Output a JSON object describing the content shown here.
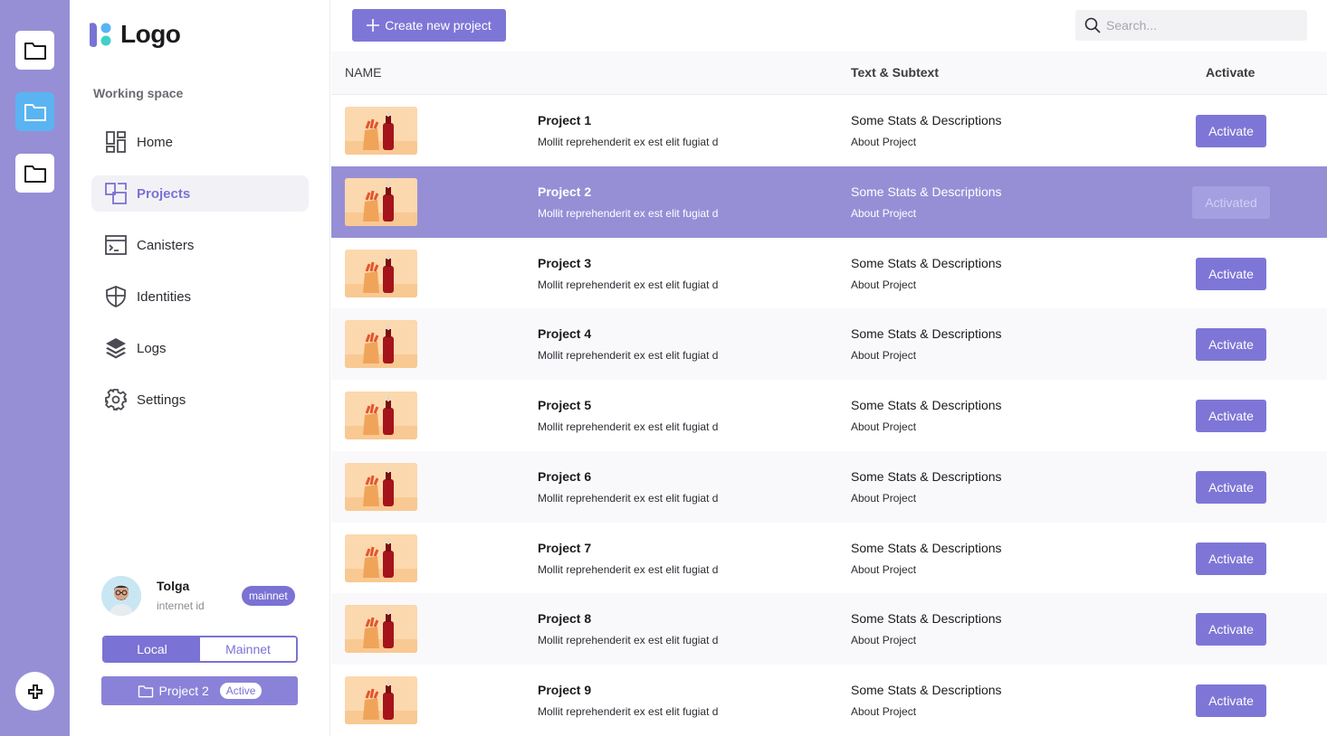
{
  "rail": {
    "items": [
      "folder-icon",
      "folder-icon",
      "folder-icon"
    ],
    "active_index": 1,
    "add": "plus-icon"
  },
  "sidebar": {
    "logo_text": "Logo",
    "section_title": "Working space",
    "nav": [
      {
        "label": "Home",
        "icon": "dashboard-icon"
      },
      {
        "label": "Projects",
        "icon": "projects-icon",
        "active": true
      },
      {
        "label": "Canisters",
        "icon": "terminal-icon"
      },
      {
        "label": "Identities",
        "icon": "shield-icon"
      },
      {
        "label": "Logs",
        "icon": "layers-icon"
      },
      {
        "label": "Settings",
        "icon": "gear-icon"
      }
    ],
    "user": {
      "name": "Tolga",
      "subtitle": "internet id",
      "network_badge": "mainnet"
    },
    "network_toggle": {
      "options": [
        "Local",
        "Mainnet"
      ],
      "selected": "Local"
    },
    "current_project": {
      "name": "Project 2",
      "status": "Active"
    }
  },
  "toolbar": {
    "create_label": "Create new project",
    "search_placeholder": "Search..."
  },
  "table": {
    "headers": {
      "name": "NAME",
      "text": "Text & Subtext",
      "activate": "Activate"
    },
    "rows": [
      {
        "name": "Project 1",
        "desc": "Mollit reprehenderit ex est elit fugiat d",
        "stat": "Some Stats & Descriptions",
        "about": "About Project",
        "button": "Activate"
      },
      {
        "name": "Project 2",
        "desc": "Mollit reprehenderit ex est elit fugiat d",
        "stat": "Some Stats & Descriptions",
        "about": "About Project",
        "button": "Activated",
        "selected": true
      },
      {
        "name": "Project 3",
        "desc": "Mollit reprehenderit ex est elit fugiat d",
        "stat": "Some Stats & Descriptions",
        "about": "About Project",
        "button": "Activate"
      },
      {
        "name": "Project 4",
        "desc": "Mollit reprehenderit ex est elit fugiat d",
        "stat": "Some Stats & Descriptions",
        "about": "About Project",
        "button": "Activate"
      },
      {
        "name": "Project 5",
        "desc": "Mollit reprehenderit ex est elit fugiat d",
        "stat": "Some Stats & Descriptions",
        "about": "About Project",
        "button": "Activate"
      },
      {
        "name": "Project 6",
        "desc": "Mollit reprehenderit ex est elit fugiat d",
        "stat": "Some Stats & Descriptions",
        "about": "About Project",
        "button": "Activate"
      },
      {
        "name": "Project 7",
        "desc": "Mollit reprehenderit ex est elit fugiat d",
        "stat": "Some Stats & Descriptions",
        "about": "About Project",
        "button": "Activate"
      },
      {
        "name": "Project 8",
        "desc": "Mollit reprehenderit ex est elit fugiat d",
        "stat": "Some Stats & Descriptions",
        "about": "About Project",
        "button": "Activate"
      },
      {
        "name": "Project 9",
        "desc": "Mollit reprehenderit ex est elit fugiat d",
        "stat": "Some Stats & Descriptions",
        "about": "About Project",
        "button": "Activate"
      }
    ]
  },
  "colors": {
    "accent": "#7e76d6",
    "rail": "#968fd6",
    "selected_row": "#968fd6",
    "rail_active": "#5ab4f2"
  }
}
